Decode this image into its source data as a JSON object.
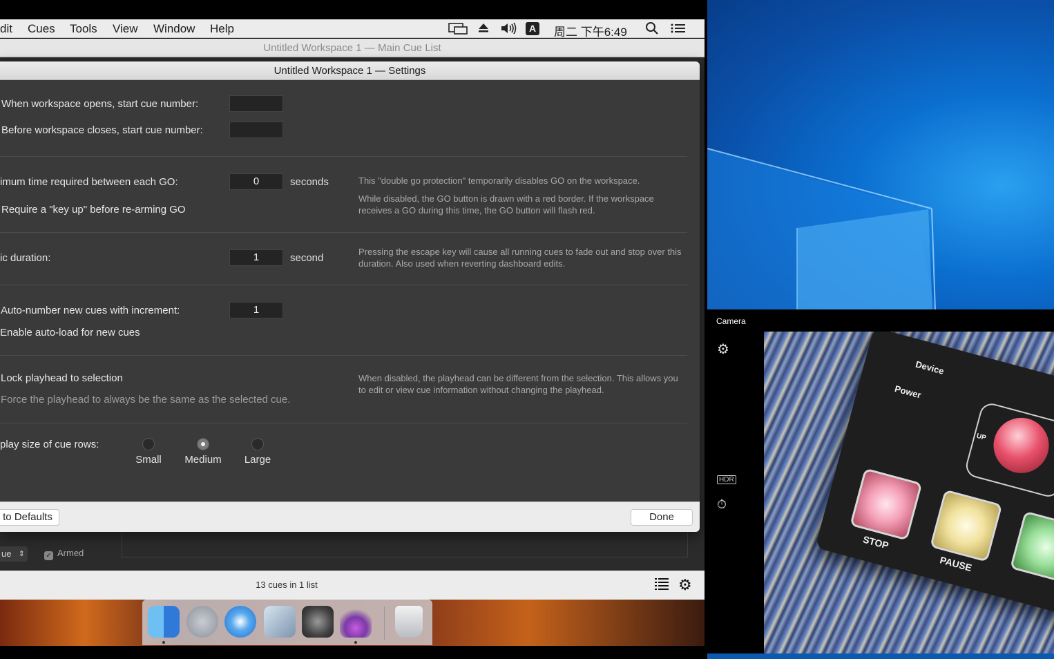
{
  "menubar": {
    "items": [
      "dit",
      "Cues",
      "Tools",
      "View",
      "Window",
      "Help"
    ],
    "input_source": "A",
    "clock": "周二 下午6:49"
  },
  "main_window": {
    "title": "Untitled Workspace 1 — Main Cue List",
    "cue_type": "ue",
    "armed_label": "Armed",
    "status": "13 cues in 1 list"
  },
  "settings": {
    "title": "Untitled Workspace 1 — Settings",
    "open_label": "When workspace opens, start cue number:",
    "open_value": "",
    "close_label": "Before workspace closes, start cue number:",
    "close_value": "",
    "min_time_label": "imum time required between each GO:",
    "min_time_value": "0",
    "min_time_unit": "seconds",
    "double_go_note": "This \"double go protection\" temporarily disables GO on the workspace.",
    "key_up_label": "Require a \"key up\" before re-arming GO",
    "key_up_note": "While disabled, the GO button is drawn with a red border. If the workspace receives a GO during this time, the GO button will flash red.",
    "panic_label": "ic duration:",
    "panic_value": "1",
    "panic_unit": "second",
    "panic_note": "Pressing the escape key will cause all running cues to fade out and stop over this duration. Also used when reverting dashboard edits.",
    "autonumber_label": "Auto-number new cues with increment:",
    "autonumber_value": "1",
    "autoload_label": "Enable auto-load for new cues",
    "lock_label": "Lock playhead to selection",
    "lock_sub": "Force the playhead to always be the same as the selected cue.",
    "lock_note": "When disabled, the playhead can be different from the selection. This allows you to edit or view cue information without changing the playhead.",
    "rowsize_label": "play size of cue rows:",
    "rowsize_options": [
      "Small",
      "Medium",
      "Large"
    ],
    "rowsize_selected": "Medium",
    "defaults_button": "to Defaults",
    "done_button": "Done"
  },
  "camera": {
    "title": "Camera",
    "hdr": "HDR",
    "device_labels": {
      "device": "Device",
      "power": "Power",
      "up": "UP",
      "stop": "STOP",
      "pause": "PAUSE"
    }
  }
}
